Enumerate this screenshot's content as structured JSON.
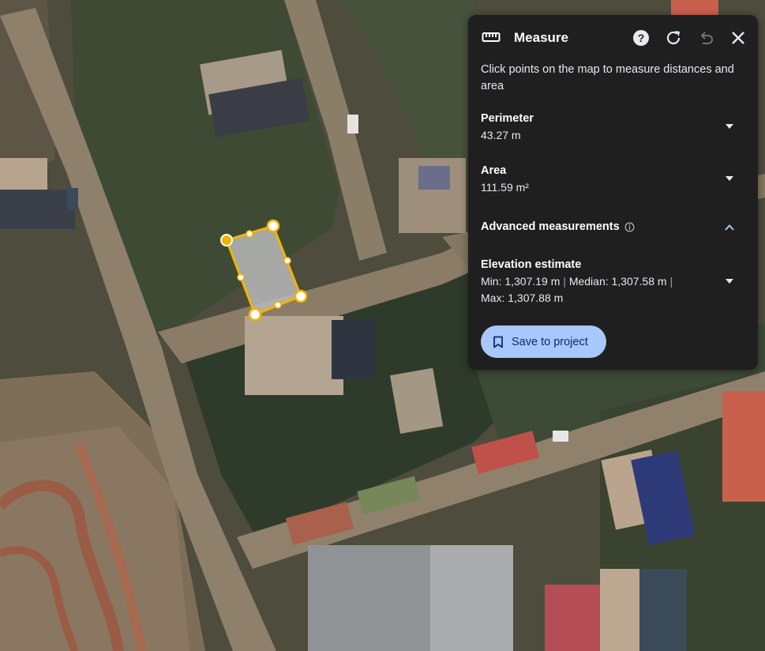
{
  "panel": {
    "title": "Measure",
    "icons": {
      "ruler": "ruler-icon",
      "help": "help-icon",
      "refresh": "refresh-icon",
      "undo": "undo-icon",
      "close": "close-icon"
    },
    "description": "Click points on the map to measure distances and area",
    "perimeter": {
      "label": "Perimeter",
      "value": "43.27 m"
    },
    "area": {
      "label": "Area",
      "value": "111.59 m²"
    },
    "advanced": {
      "label": "Advanced measurements",
      "expanded": true
    },
    "elevation": {
      "label": "Elevation estimate",
      "min": "Min: 1,307.19 m",
      "median": "Median: 1,307.58 m",
      "max": "Max: 1,307.88 m",
      "separator": "|"
    },
    "save_button": "Save to project"
  },
  "colors": {
    "panel_bg": "#1f1f1f",
    "accent": "#a8c7fa",
    "accent_text": "#062e6f",
    "polygon_stroke": "#f2b400",
    "polygon_fill": "#b8b8b8",
    "chevron": "#a8c7fa"
  }
}
